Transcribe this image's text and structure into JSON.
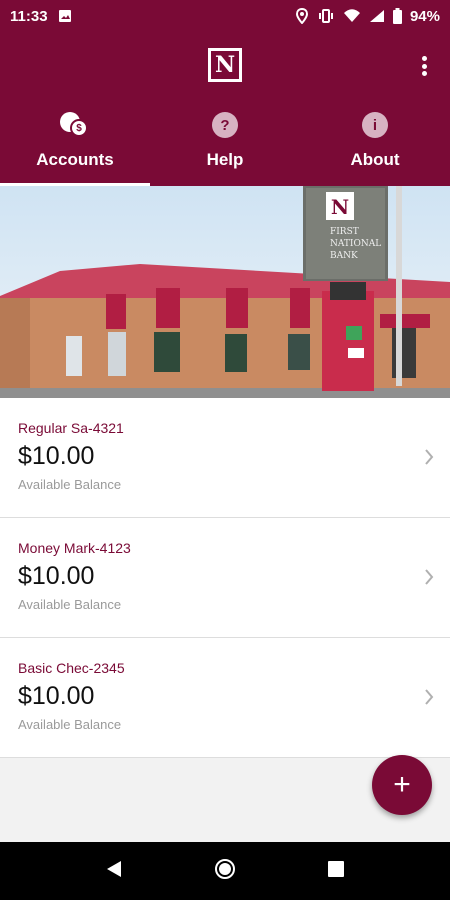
{
  "status_bar": {
    "time": "11:33",
    "battery_percent": "94%",
    "icons": [
      "image-icon",
      "location-icon",
      "vibrate-icon",
      "wifi-icon",
      "signal-icon",
      "battery-icon"
    ]
  },
  "app_bar": {
    "logo_text": "N",
    "tabs": [
      {
        "label": "Accounts",
        "icon": "coins-icon",
        "active": true
      },
      {
        "label": "Help",
        "icon": "question-icon",
        "active": false
      },
      {
        "label": "About",
        "icon": "info-icon",
        "active": false
      }
    ]
  },
  "hero": {
    "sign_text": [
      "FIRST",
      "NATIONAL",
      "BANK"
    ]
  },
  "accounts": [
    {
      "name": "Regular Sa-4321",
      "balance": "$10.00",
      "balance_label": "Available Balance"
    },
    {
      "name": "Money Mark-4123",
      "balance": "$10.00",
      "balance_label": "Available Balance"
    },
    {
      "name": "Basic Chec-2345",
      "balance": "$10.00",
      "balance_label": "Available Balance"
    }
  ],
  "fab": {
    "label": "+"
  },
  "colors": {
    "brand": "#7a0a36",
    "chevron": "#b0b0b0",
    "subtext": "#9a9a9a"
  }
}
